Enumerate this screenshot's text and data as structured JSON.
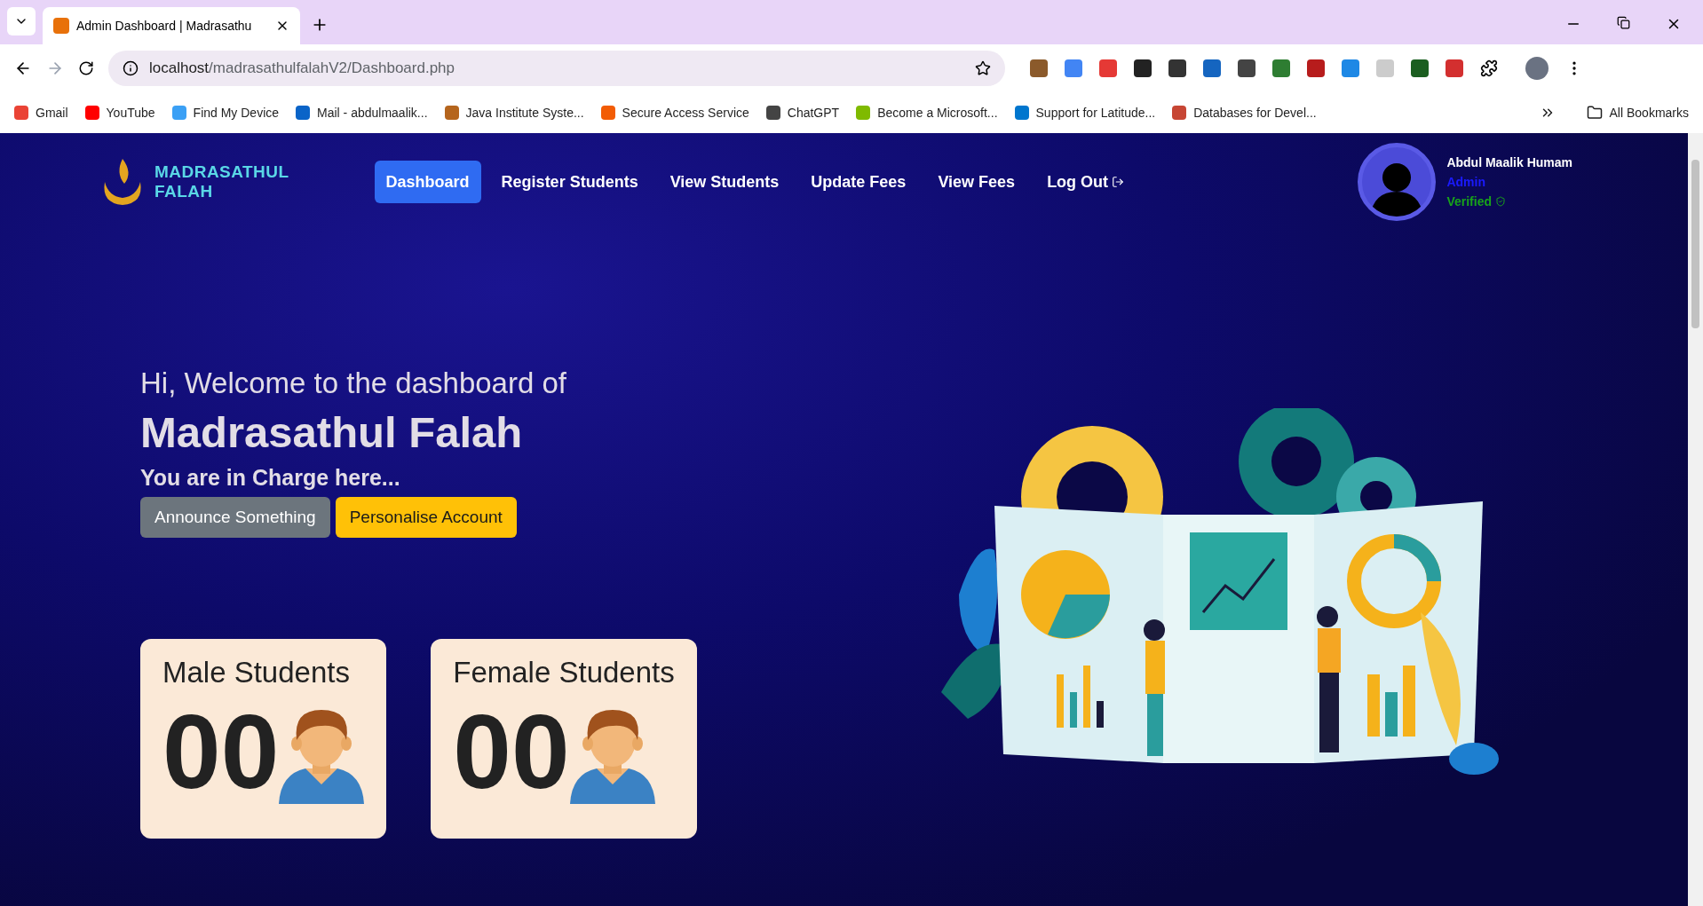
{
  "browser": {
    "tab_title": "Admin Dashboard | Madrasathu",
    "url_host": "localhost",
    "url_path": "/madrasathulfalahV2/Dashboard.php",
    "bookmarks": [
      {
        "label": "Gmail",
        "color": "#ea4335"
      },
      {
        "label": "YouTube",
        "color": "#ff0000"
      },
      {
        "label": "Find My Device",
        "color": "#3ba0f5"
      },
      {
        "label": "Mail - abdulmaalik...",
        "color": "#0a64c8"
      },
      {
        "label": "Java Institute Syste...",
        "color": "#b5651d"
      },
      {
        "label": "Secure Access Service",
        "color": "#f25c05"
      },
      {
        "label": "ChatGPT",
        "color": "#444444"
      },
      {
        "label": "Become a Microsoft...",
        "color": "#7fba00"
      },
      {
        "label": "Support for Latitude...",
        "color": "#0076ce"
      },
      {
        "label": "Databases for Devel...",
        "color": "#c74634"
      }
    ],
    "all_bookmarks": "All Bookmarks"
  },
  "nav": {
    "brand": [
      "MADRASATHUL",
      "FALAH"
    ],
    "links": [
      {
        "label": "Dashboard",
        "selected": true
      },
      {
        "label": "Register Students",
        "selected": false
      },
      {
        "label": "View Students",
        "selected": false
      },
      {
        "label": "Update Fees",
        "selected": false
      },
      {
        "label": "View Fees",
        "selected": false
      },
      {
        "label": "Log Out",
        "selected": false
      }
    ],
    "user": {
      "name": "Abdul Maalik Humam",
      "role": "Admin",
      "status": "Verified"
    }
  },
  "hero": {
    "greeting": "Hi, Welcome to the dashboard of",
    "title": "Madrasathul Falah",
    "subtitle": "You are in Charge here...",
    "buttons": [
      {
        "label": "Announce Something",
        "kind": "secondary"
      },
      {
        "label": "Personalise Account",
        "kind": "warning"
      }
    ]
  },
  "cards": [
    {
      "title": "Male Students",
      "count": "00"
    },
    {
      "title": "Female Students",
      "count": "00"
    }
  ]
}
